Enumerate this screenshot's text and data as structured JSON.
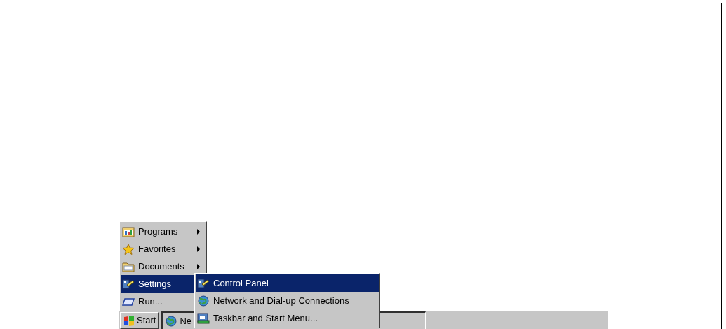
{
  "start_menu": {
    "items": [
      {
        "label": "Programs",
        "has_submenu": true,
        "selected": false
      },
      {
        "label": "Favorites",
        "has_submenu": true,
        "selected": false
      },
      {
        "label": "Documents",
        "has_submenu": true,
        "selected": false
      },
      {
        "label": "Settings",
        "has_submenu": true,
        "selected": true
      },
      {
        "label": "Run...",
        "has_submenu": false,
        "selected": false
      }
    ]
  },
  "settings_submenu": {
    "items": [
      {
        "label": "Control Panel",
        "selected": true
      },
      {
        "label": "Network and Dial-up Connections",
        "selected": false
      },
      {
        "label": "Taskbar and Start Menu...",
        "selected": false
      }
    ]
  },
  "taskbar": {
    "start_button": "Start",
    "task_buttons": [
      {
        "label": "Ne",
        "selected": true
      }
    ]
  }
}
